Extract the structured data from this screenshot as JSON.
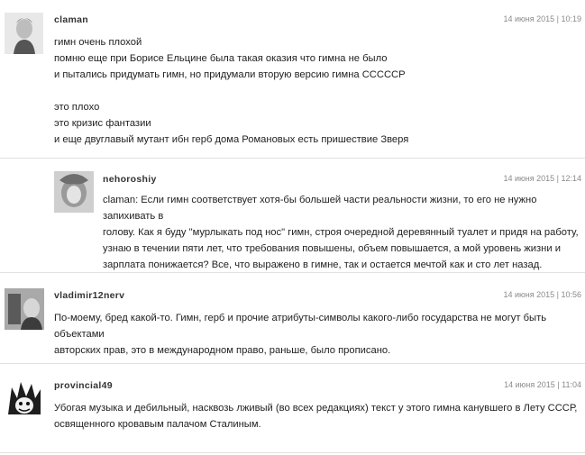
{
  "comments": [
    {
      "author": "claman",
      "meta": "14 июня 2015 | 10:19",
      "lines": [
        "гимн очень плохой",
        "помню еще при Борисе Ельцине была такая оказия что гимна не было",
        "и пытались придумать гимн, но придумали вторую версию гимна СССССР",
        "",
        "это плохо",
        "это кризис фантазии",
        "и еще двуглавый мутант ибн герб дома Романовых есть пришествие Зверя"
      ]
    },
    {
      "author": "nehoroshiy",
      "meta": "14 июня 2015 | 12:14",
      "lines": [
        "claman: Если гимн соответствует хотя-бы большей части реальности жизни, то его не нужно запихивать в",
        "голову. Как я буду \"мурлыкать под нос\" гимн, строя очередной деревянный туалет и придя на работу,",
        "узнаю в течении пяти лет, что требования повышены, объем повышается, а мой уровень жизни и",
        "зарплата понижается? Все, что выражено в гимне, так и остается мечтой как и сто лет назад."
      ]
    },
    {
      "author": "vladimir12nerv",
      "meta": "14 июня 2015 | 10:56",
      "lines": [
        "По-моему, бред какой-то. Гимн, герб и прочие атрибуты-символы какого-либо государства не могут быть объектами",
        "авторских прав, это в международном право, раньше, было прописано."
      ]
    },
    {
      "author": "provincial49",
      "meta": "14 июня 2015 | 11:04",
      "lines": [
        "Убогая музыка и дебильный, насквозь лживый (во всех редакциях) текст у этого гимна канувшего в Лету СССР,",
        "освященного кровавым палачом Сталиным."
      ]
    }
  ]
}
